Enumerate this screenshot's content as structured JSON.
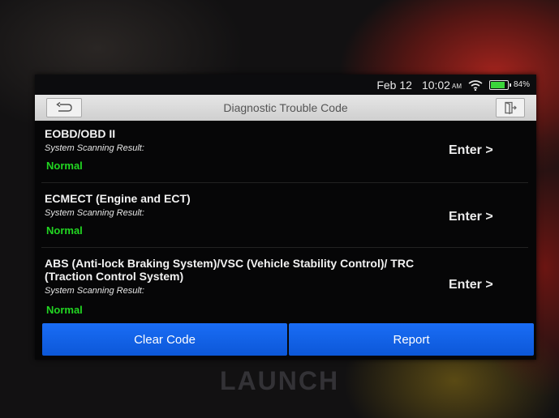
{
  "status_bar": {
    "date": "Feb 12",
    "time": "10:02",
    "ampm": "AM",
    "battery_percent": "84%",
    "battery_level": 0.84,
    "wifi_icon": "wifi-icon",
    "battery_icon": "battery-icon"
  },
  "header": {
    "title": "Diagnostic Trouble Code",
    "back_icon": "back-arrow-icon",
    "exit_icon": "exit-icon"
  },
  "systems": [
    {
      "name": "EOBD/OBD II",
      "result_label": "System Scanning Result:",
      "status": "Normal",
      "action": "Enter >"
    },
    {
      "name": "ECMECT (Engine and ECT)",
      "result_label": "System Scanning Result:",
      "status": "Normal",
      "action": "Enter >"
    },
    {
      "name": "ABS (Anti-lock Braking System)/VSC (Vehicle Stability Control)/ TRC (Traction Control System)",
      "result_label": "System Scanning Result:",
      "status": "Normal",
      "action": "Enter >"
    }
  ],
  "footer": {
    "clear_code": "Clear Code",
    "report": "Report"
  },
  "brand": "LAUNCH",
  "colors": {
    "status_normal": "#22d622",
    "button_blue": "#1466ea",
    "battery_green": "#3ad63a"
  }
}
